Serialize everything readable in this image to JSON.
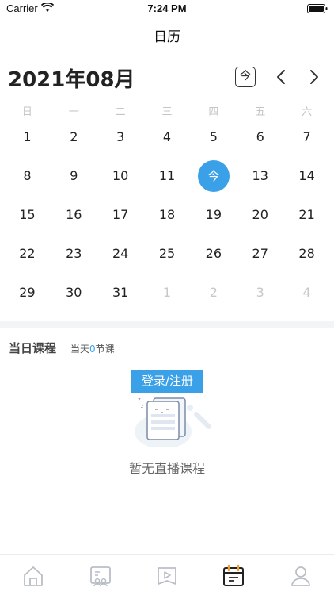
{
  "status_bar": {
    "carrier": "Carrier",
    "time": "7:24 PM"
  },
  "nav": {
    "title": "日历"
  },
  "calendar": {
    "month_title": "2021年08月",
    "today_label": "今",
    "weekdays": [
      "日",
      "一",
      "二",
      "三",
      "四",
      "五",
      "六"
    ],
    "days": [
      {
        "label": "1",
        "state": "current"
      },
      {
        "label": "2",
        "state": "current"
      },
      {
        "label": "3",
        "state": "current"
      },
      {
        "label": "4",
        "state": "current"
      },
      {
        "label": "5",
        "state": "current"
      },
      {
        "label": "6",
        "state": "current"
      },
      {
        "label": "7",
        "state": "current"
      },
      {
        "label": "8",
        "state": "current"
      },
      {
        "label": "9",
        "state": "current"
      },
      {
        "label": "10",
        "state": "current"
      },
      {
        "label": "11",
        "state": "current"
      },
      {
        "label": "今",
        "state": "today"
      },
      {
        "label": "13",
        "state": "current"
      },
      {
        "label": "14",
        "state": "current"
      },
      {
        "label": "15",
        "state": "current"
      },
      {
        "label": "16",
        "state": "current"
      },
      {
        "label": "17",
        "state": "current"
      },
      {
        "label": "18",
        "state": "current"
      },
      {
        "label": "19",
        "state": "current"
      },
      {
        "label": "20",
        "state": "current"
      },
      {
        "label": "21",
        "state": "current"
      },
      {
        "label": "22",
        "state": "current"
      },
      {
        "label": "23",
        "state": "current"
      },
      {
        "label": "24",
        "state": "current"
      },
      {
        "label": "25",
        "state": "current"
      },
      {
        "label": "26",
        "state": "current"
      },
      {
        "label": "27",
        "state": "current"
      },
      {
        "label": "28",
        "state": "current"
      },
      {
        "label": "29",
        "state": "current"
      },
      {
        "label": "30",
        "state": "current"
      },
      {
        "label": "31",
        "state": "current"
      },
      {
        "label": "1",
        "state": "other"
      },
      {
        "label": "2",
        "state": "other"
      },
      {
        "label": "3",
        "state": "other"
      },
      {
        "label": "4",
        "state": "other"
      }
    ]
  },
  "courses": {
    "title": "当日课程",
    "count_prefix": "当天",
    "count": "0",
    "count_suffix": "节课",
    "login_label": "登录/注册",
    "empty_text": "暂无直播课程"
  },
  "tab_bar": {
    "items": [
      {
        "icon": "home-icon",
        "active": false
      },
      {
        "icon": "live-class-icon",
        "active": false
      },
      {
        "icon": "video-book-icon",
        "active": false
      },
      {
        "icon": "calendar-icon",
        "active": true
      },
      {
        "icon": "profile-icon",
        "active": false
      }
    ]
  },
  "colors": {
    "accent": "#3aa0e8",
    "calendar_ring": "#f0a030"
  }
}
